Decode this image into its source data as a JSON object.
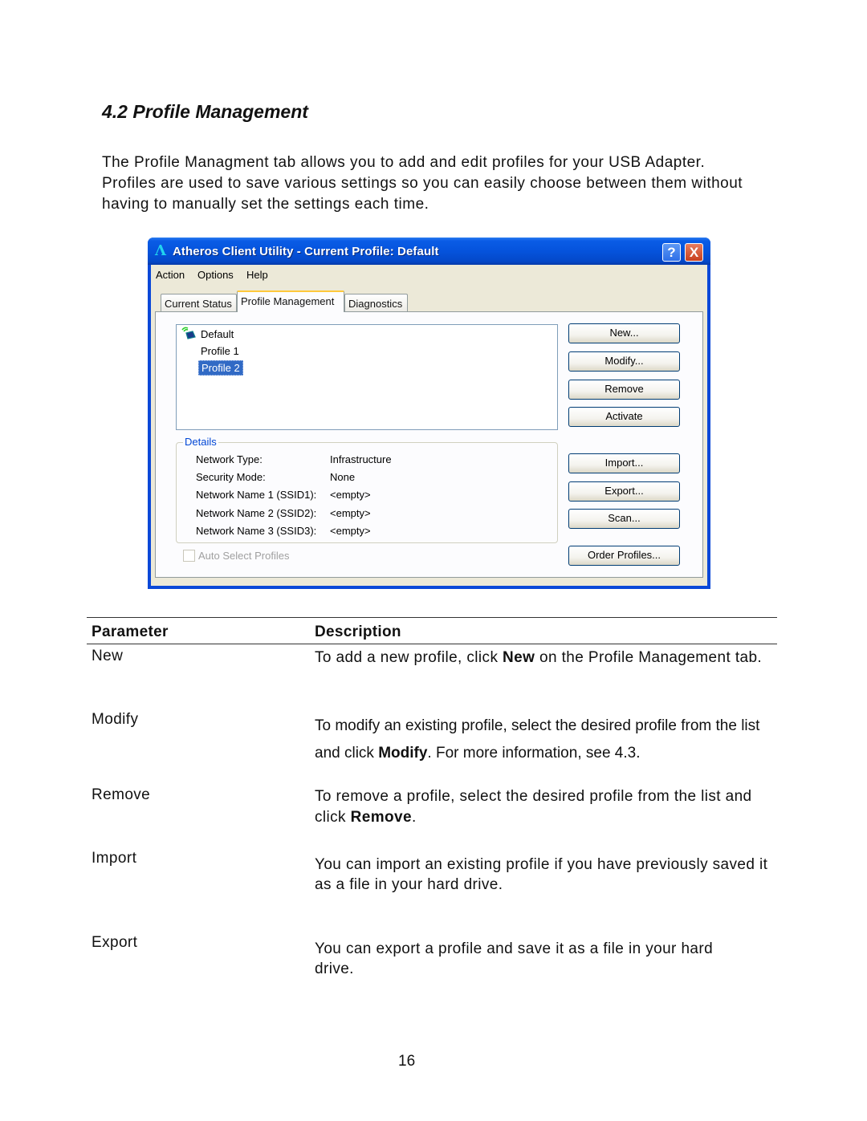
{
  "document": {
    "heading": "4.2 Profile Management",
    "intro": "The Profile Managment tab allows you to add and edit profiles for your USB Adapter. Profiles are used to save various settings so you can easily choose between them without having to manually set the settings each time.",
    "page_number": "16"
  },
  "window": {
    "title": "Atheros Client Utility - Current Profile: Default",
    "app_icon": "atheros-logo-icon",
    "help_button": "?",
    "close_button": "X",
    "menu": [
      "Action",
      "Options",
      "Help"
    ],
    "tabs": [
      {
        "label": "Current Status",
        "active": false
      },
      {
        "label": "Profile Management",
        "active": true
      },
      {
        "label": "Diagnostics",
        "active": false
      }
    ],
    "profiles": [
      {
        "name": "Default",
        "icon": "active-profile-icon",
        "selected": false
      },
      {
        "name": "Profile 1",
        "selected": false
      },
      {
        "name": "Profile 2",
        "selected": true
      }
    ],
    "details": {
      "label": "Details",
      "rows": [
        {
          "label": "Network Type:",
          "value": "Infrastructure"
        },
        {
          "label": "Security Mode:",
          "value": "None"
        },
        {
          "label": "Network Name 1 (SSID1):",
          "value": "<empty>"
        },
        {
          "label": "Network Name 2 (SSID2):",
          "value": "<empty>"
        },
        {
          "label": "Network Name 3 (SSID3):",
          "value": "<empty>"
        }
      ]
    },
    "auto_select": {
      "label": "Auto Select Profiles",
      "checked": false,
      "disabled": true
    },
    "buttons": {
      "new": "New...",
      "modify": "Modify...",
      "remove": "Remove",
      "activate": "Activate",
      "import": "Import...",
      "export": "Export...",
      "scan": "Scan...",
      "order": "Order Profiles..."
    },
    "colors": {
      "titlebar": "#0553dc",
      "selection": "#316ac5",
      "group_label": "#0046d5",
      "dialog_bg": "#ece9d8"
    }
  },
  "table": {
    "headers": [
      "Parameter",
      "Description"
    ],
    "rows": [
      {
        "param": "New",
        "pre": "To add a new profile, click ",
        "bold": "New",
        "post": " on the Profile Management tab."
      },
      {
        "param": "Modify",
        "pre": "To modify an existing profile, select the desired profile from the list and click ",
        "bold": "Modify",
        "post": ".  For more information, see 4.3."
      },
      {
        "param": "Remove",
        "pre": "To remove a profile, select the desired profile from the list and click ",
        "bold": "Remove",
        "post": "."
      },
      {
        "param": "Import",
        "pre": "You can import an existing profile if you have previously saved it as a file in your hard drive.",
        "bold": "",
        "post": ""
      },
      {
        "param": "Export",
        "pre": "You can export a profile and save it as a file in your hard drive.",
        "bold": "",
        "post": ""
      }
    ]
  }
}
